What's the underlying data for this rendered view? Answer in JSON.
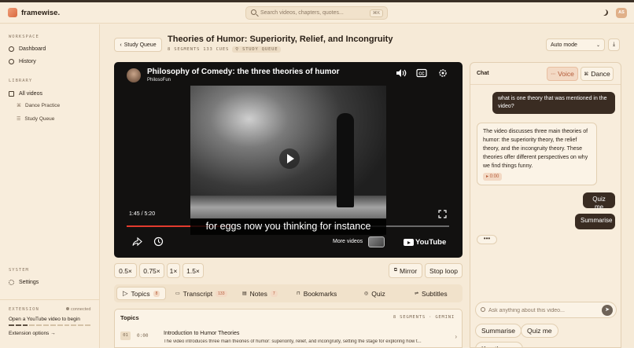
{
  "app": {
    "name": "framewise.",
    "user_initials": "AS"
  },
  "search": {
    "placeholder": "Search videos, chapters, quotes...",
    "shortcut": "⌘K"
  },
  "sidebar": {
    "workspace_label": "WORKSPACE",
    "workspace_items": [
      {
        "label": "Dashboard",
        "icon": "dashboard-icon"
      },
      {
        "label": "History",
        "icon": "clock-icon"
      }
    ],
    "library_label": "LIBRARY",
    "library_items": [
      {
        "label": "All videos",
        "icon": "grid-icon"
      },
      {
        "label": "Dance Practice",
        "icon": "dance-icon"
      },
      {
        "label": "Study Queue",
        "icon": "list-icon"
      }
    ],
    "system_label": "SYSTEM",
    "system_items": [
      {
        "label": "Settings",
        "icon": "gear-icon"
      }
    ],
    "extension": {
      "label": "EXTENSION",
      "status": "connected",
      "message": "Open a YouTube video to begin",
      "link": "Extension options →"
    }
  },
  "page": {
    "back_label": "Study Queue",
    "title": "Theories of Humor: Superiority, Relief, and Incongruity",
    "meta": "8 SEGMENTS  133 CUES",
    "badge": "STUDY QUEUE",
    "mode_select": "Auto mode"
  },
  "video": {
    "title": "Philosophy of Comedy: the three theories of humor",
    "channel": "PhilosoFun",
    "time": "1:45 / 5:20",
    "progress": 0.33,
    "subtitle": "for eggs now you thinking for instance",
    "more_videos": "More videos",
    "brand": "YouTube"
  },
  "controls": {
    "speeds": [
      "0.5×",
      "0.75×",
      "1×",
      "1.5×"
    ],
    "mirror": "Mirror",
    "stop_loop": "Stop loop"
  },
  "tabs": [
    {
      "label": "Topics",
      "count": "8"
    },
    {
      "label": "Transcript",
      "count": "133"
    },
    {
      "label": "Notes",
      "count": "7"
    },
    {
      "label": "Bookmarks",
      "count": ""
    },
    {
      "label": "Quiz",
      "count": ""
    },
    {
      "label": "Subtitles",
      "count": ""
    }
  ],
  "topics": {
    "header": "Topics",
    "meta": "8 SEGMENTS · GEMINI",
    "items": [
      {
        "num": "01",
        "time": "0:00",
        "title": "Introduction to Humor Theories",
        "desc": "The video introduces three main theories of humor: superiority, relief, and incongruity, setting the stage for exploring how t..."
      }
    ]
  },
  "chat": {
    "title": "Chat",
    "voice_label": "Voice",
    "dance_label": "Dance",
    "messages": [
      {
        "role": "user",
        "text": "what is one theory that was mentioned in the video?"
      },
      {
        "role": "bot",
        "text": "The video discusses three main theories of humor: the superiority theory, the relief theory, and the incongruity theory. These theories offer different perspectives on why we find things funny.",
        "timestamp": "▸ 0:00"
      },
      {
        "role": "user",
        "text": "Quiz me"
      },
      {
        "role": "user",
        "text": "Summarise"
      }
    ],
    "typing": "•••",
    "input_placeholder": "Ask anything about this video...",
    "suggestions": [
      "Summarise",
      "Quiz me",
      "Key themes"
    ]
  },
  "colors": {
    "accent": "#d9683f",
    "background": "#f6ead7",
    "dark": "#3a2c22"
  }
}
